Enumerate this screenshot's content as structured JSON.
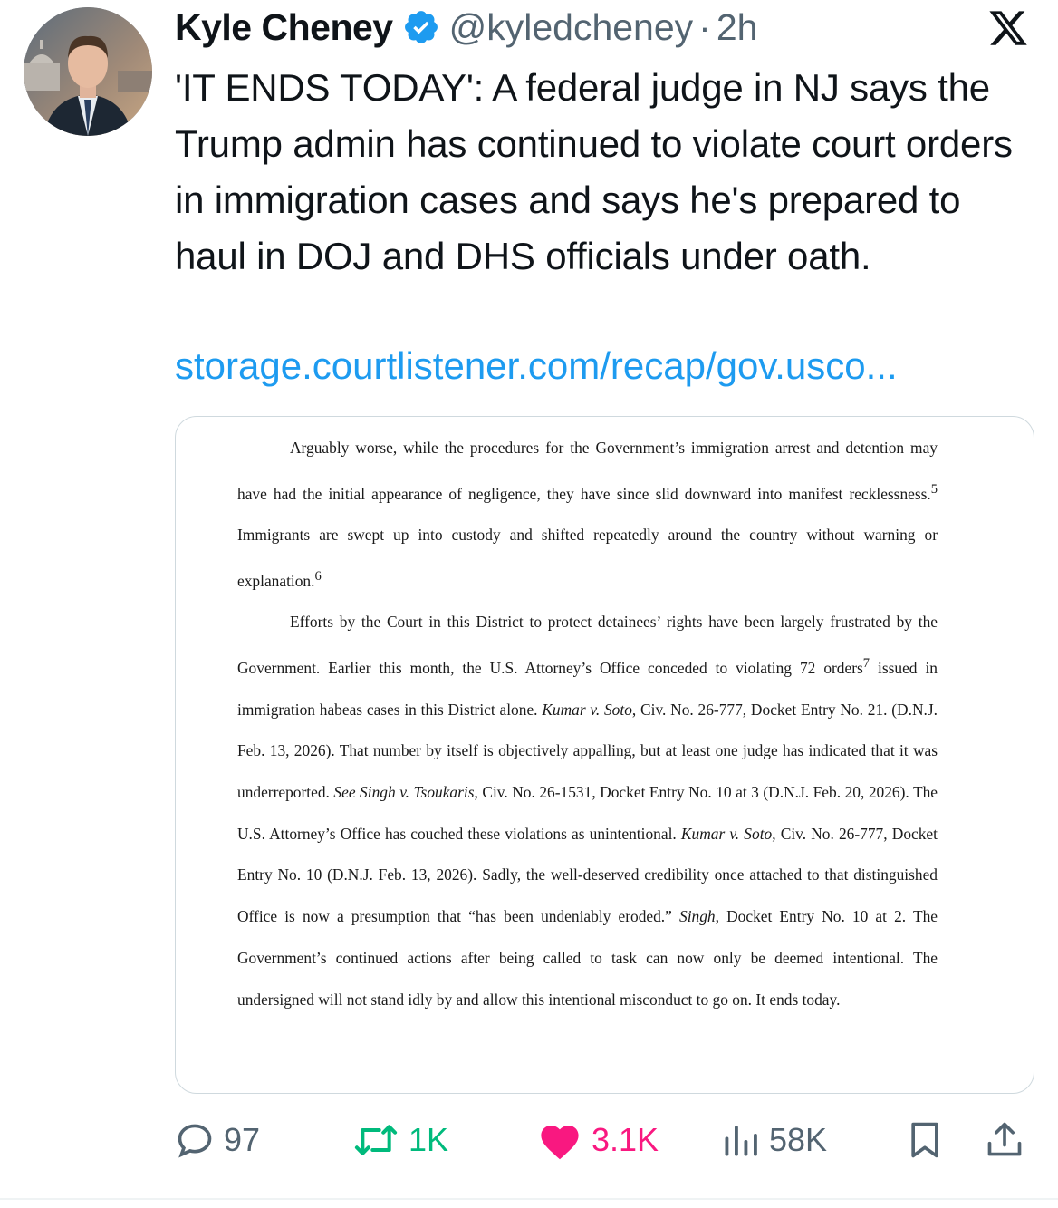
{
  "tweet": {
    "author_name": "Kyle Cheney",
    "handle": "@kyledcheney",
    "separator": "·",
    "time": "2h",
    "text": "'IT ENDS TODAY': A federal judge in NJ says the Trump admin has continued to violate court orders in immigration cases and says he's prepared to haul in DOJ and DHS officials under oath.",
    "link": "storage.courtlistener.com/recap/gov.usco..."
  },
  "document": {
    "p1": {
      "a": "Arguably worse, while the procedures for the Government’s immigration arrest and detention may have had the initial appearance of negligence, they have since slid downward into manifest recklessness.",
      "fn5": "5",
      "b": " Immigrants are swept up into custody and shifted repeatedly around the country without warning or explanation.",
      "fn6": "6"
    },
    "p2": {
      "a": "Efforts by the Court in this District to protect detainees’ rights have been largely frustrated by the Government. Earlier this month, the U.S. Attorney’s Office conceded to violating 72 orders",
      "fn7": "7",
      "b": " issued in immigration habeas cases in this District alone. ",
      "case1": "Kumar v. Soto",
      "c": ", Civ. No. 26-777, Docket Entry No. 21. (D.N.J. Feb. 13, 2026). That number by itself is objectively appalling, but at least one judge has indicated that it was underreported. ",
      "case2": "See Singh v. Tsoukaris",
      "d": ", Civ. No. 26-1531, Docket Entry No. 10 at 3 (D.N.J. Feb. 20, 2026). The U.S. Attorney’s Office has couched these violations as unintentional. ",
      "case3": "Kumar v. Soto",
      "e": ", Civ. No. 26-777, Docket Entry No. 10 (D.N.J. Feb. 13, 2026). Sadly, the well-deserved credibility once attached to that distinguished Office is now a presumption that “has been undeniably eroded.” ",
      "case4": "Singh",
      "f": ", Docket Entry No. 10 at 2. The Government’s continued actions after being called to task can now only be deemed intentional. The undersigned will not stand idly by and allow this intentional misconduct to go on. It ends today."
    }
  },
  "actions": {
    "replies": "97",
    "reposts": "1K",
    "likes": "3.1K",
    "views": "58K"
  },
  "colors": {
    "text": "#0f1419",
    "secondary": "#536471",
    "link": "#1d9bf0",
    "verified": "#1d9bf0",
    "repost": "#00ba7c",
    "like": "#f91880"
  },
  "icons": [
    "verified-badge-icon",
    "x-logo-icon",
    "reply-icon",
    "repost-icon",
    "heart-icon",
    "views-icon",
    "bookmark-icon",
    "share-icon"
  ]
}
